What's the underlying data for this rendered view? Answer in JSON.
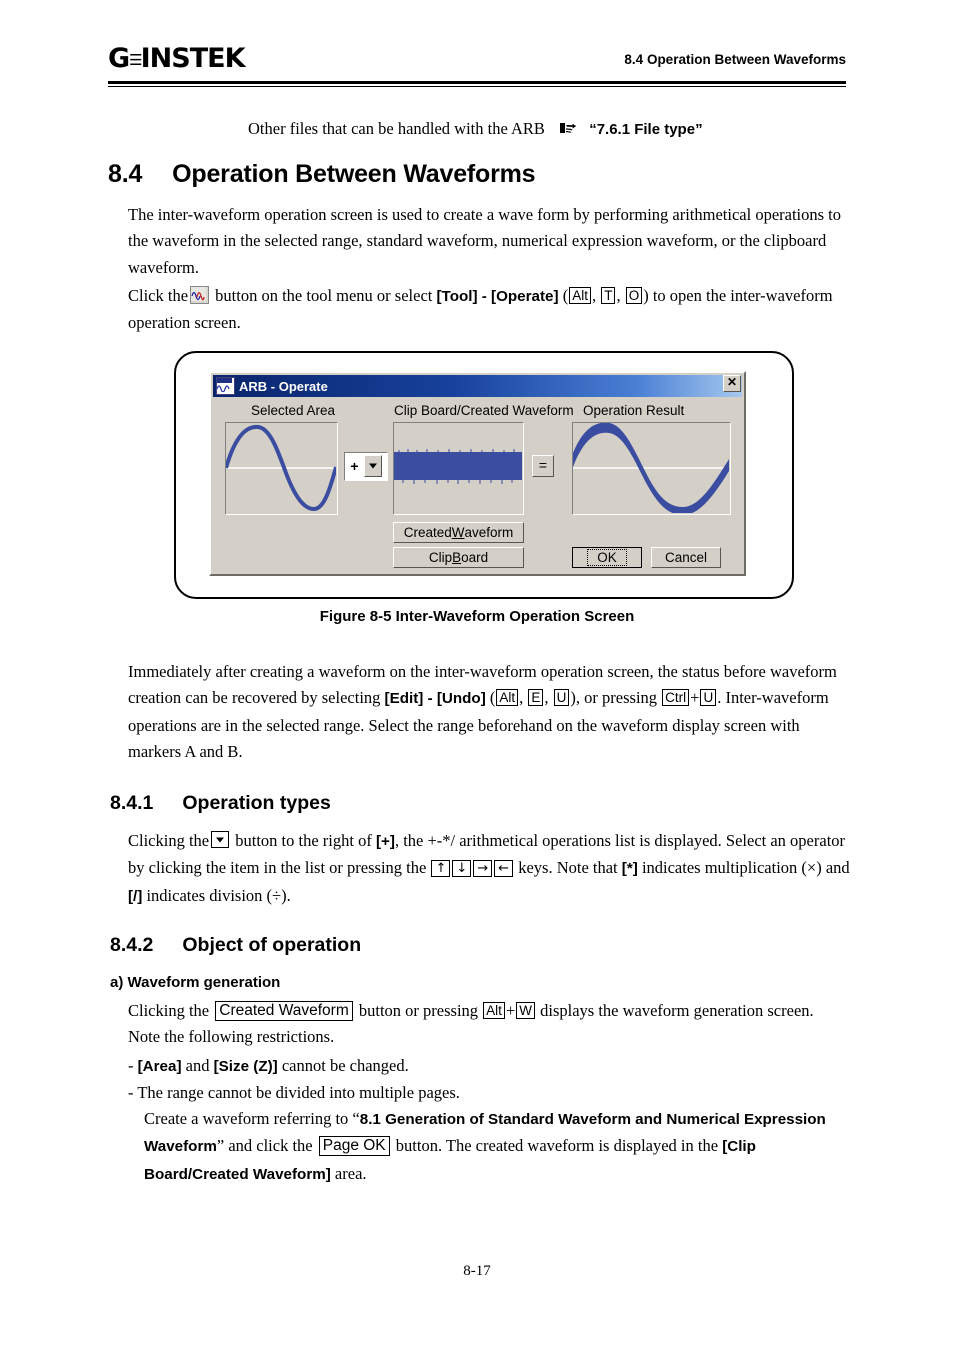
{
  "header": {
    "logo_gw": "G",
    "logo_u": "☰",
    "logo_instek": "INSTEK",
    "title": "8.4 Operation Between Waveforms"
  },
  "intro": {
    "text": "Other files that can be handled with the ARB",
    "icon": "pointing-hand-icon",
    "reference": "“7.6.1 File type”"
  },
  "section_84": {
    "number": "8.4",
    "title": "Operation Between Waveforms",
    "para1_a": "The inter-waveform operation screen is used to create a wave form by performing arithmetical operations to the waveform in the selected range, standard waveform, numerical expression waveform, or the clipboard waveform.",
    "para2_pre": "Click the",
    "para2_mid": "button on the tool menu or select",
    "para2_menu": "[Tool] - [Operate]",
    "para2_open": "(",
    "key_alt": "Alt",
    "key_t": "T",
    "key_o": "O",
    "para2_end": ") to open the inter-waveform operation screen.",
    "comma": ",",
    "icon_tool": "waveform-tool-icon"
  },
  "figure": {
    "caption": "Figure 8-5 Inter-Waveform Operation Screen",
    "dialog": {
      "title": "ARB - Operate",
      "title_icon": "waveform-window-icon",
      "close_label": "✕",
      "panels": [
        {
          "label": "Selected Area",
          "waveform": "sine"
        },
        {
          "label": "Clip Board/Created Waveform",
          "waveform": "noise-band"
        },
        {
          "label": "Operation Result",
          "waveform": "noisy-sine"
        }
      ],
      "operator_value": "+",
      "operator_arrow": "chevron-down-icon",
      "equals_sign": "=",
      "buttons": {
        "created_waveform": {
          "pre": "Created ",
          "mnemonic": "W",
          "post": "aveform"
        },
        "clip_board": {
          "pre": "Clip ",
          "mnemonic": "B",
          "post": "oard"
        },
        "ok": "OK",
        "cancel": "Cancel"
      }
    }
  },
  "after_figure": {
    "line1": "Immediately after creating a waveform on the inter-waveform operation screen, the status before",
    "line2_pre": "waveform creation can be recovered by selecting",
    "line2_menu": "[Edit] - [Undo]",
    "line2_open": "(",
    "key_alt": "Alt",
    "key_e": "E",
    "key_u": "U",
    "line2_mid": "), or pressing",
    "key_ctrl": "Ctrl",
    "plus": "+",
    "key_u2": "U",
    "period": ".",
    "line3": "Inter-waveform operations are in the selected range.  Select the range beforehand on the waveform",
    "line4": "display screen with markers A and B.",
    "comma": ","
  },
  "section_841": {
    "number": "8.4.1",
    "title": "Operation types",
    "line1_pre": "Clicking the",
    "line1_icon": "chevron-down-icon",
    "line1_mid": "button to the right of",
    "line1_bold": "[+]",
    "line1_post": ", the +-*/ arithmetical operations list is displayed.",
    "line2_pre": "Select an operator by clicking the item in the list or pressing the",
    "keys": [
      "↑",
      "↓",
      "→",
      "←"
    ],
    "line2_post": "keys.",
    "line3_pre": "Note that",
    "line3_star": "[*]",
    "line3_mid": "indicates multiplication (×) and",
    "line3_slash": "[/]",
    "line3_post": "indicates division (÷)."
  },
  "section_842": {
    "number": "8.4.2",
    "title": "Object of operation",
    "subheading": "a) Waveform generation",
    "line1_pre": "Clicking the",
    "btn_created_waveform": "Created Waveform",
    "line1_mid": "button or pressing",
    "key_alt": "Alt",
    "plus": "+",
    "key_w": "W",
    "line1_post": "displays the waveform generation",
    "line2": "screen. Note the following restrictions.",
    "bullets": [
      {
        "dash": "-",
        "bold1": "[Area]",
        "mid": "and",
        "bold2": "[Size (Z)]",
        "tail": "cannot be changed."
      },
      {
        "dash": "-",
        "text": "The range cannot be divided into multiple pages."
      }
    ],
    "final_pre": "Create a waveform referring to “",
    "final_bold1": "8.1 Generation of Standard Waveform and Numerical",
    "final_bold2": "Expression Waveform",
    "final_mid1": "” and click the",
    "btn_page_ok": "Page OK",
    "final_mid2": "button. The created waveform is displayed in",
    "final_mid3": "the",
    "final_bold3": "[Clip Board/Created Waveform]",
    "final_tail": "area."
  },
  "footer": {
    "page_number": "8-17"
  },
  "colors": {
    "waveform_blue": "#3b4da0",
    "dialog_face": "#d4d0c8",
    "title_blue": "#0a246a"
  }
}
